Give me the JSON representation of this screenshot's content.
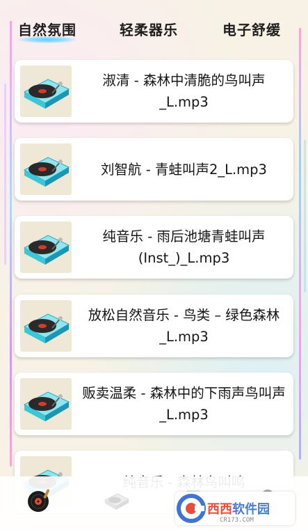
{
  "tabs": [
    {
      "label": "自然氛围",
      "active": true
    },
    {
      "label": "轻柔器乐",
      "active": false
    },
    {
      "label": "电子舒缓",
      "active": false
    }
  ],
  "tracks": [
    {
      "title": "淑清 - 森林中清脆的鸟叫声_L.mp3",
      "icon": "turntable-icon"
    },
    {
      "title": "刘智航 - 青蛙叫声2_L.mp3",
      "icon": "turntable-icon"
    },
    {
      "title": "纯音乐 - 雨后池塘青蛙叫声(Inst_)_L.mp3",
      "icon": "turntable-icon"
    },
    {
      "title": "放松自然音乐 - 鸟类 – 绿色森林_L.mp3",
      "icon": "turntable-icon"
    },
    {
      "title": "贩卖温柔 - 森林中的下雨声鸟叫声_L.mp3",
      "icon": "turntable-icon"
    },
    {
      "title": "纯音乐 - 森林鸟叫鸣",
      "icon": "turntable-icon"
    }
  ],
  "bottom_nav": [
    {
      "icon": "vinyl-record-icon",
      "active": true
    },
    {
      "icon": "turntable-icon",
      "active": false
    },
    {
      "icon": "game-box-icon",
      "active": false
    },
    {
      "icon": "avatar-icon",
      "active": false
    }
  ],
  "watermark": {
    "brand": "西西软件园",
    "brand_highlight": "西西",
    "brand_rest": "软件园",
    "url": "CR173.COM"
  },
  "colors": {
    "accent": "#6fc7ff",
    "frame_pink": "#ff67c9",
    "card_bg": "#ffffff"
  }
}
